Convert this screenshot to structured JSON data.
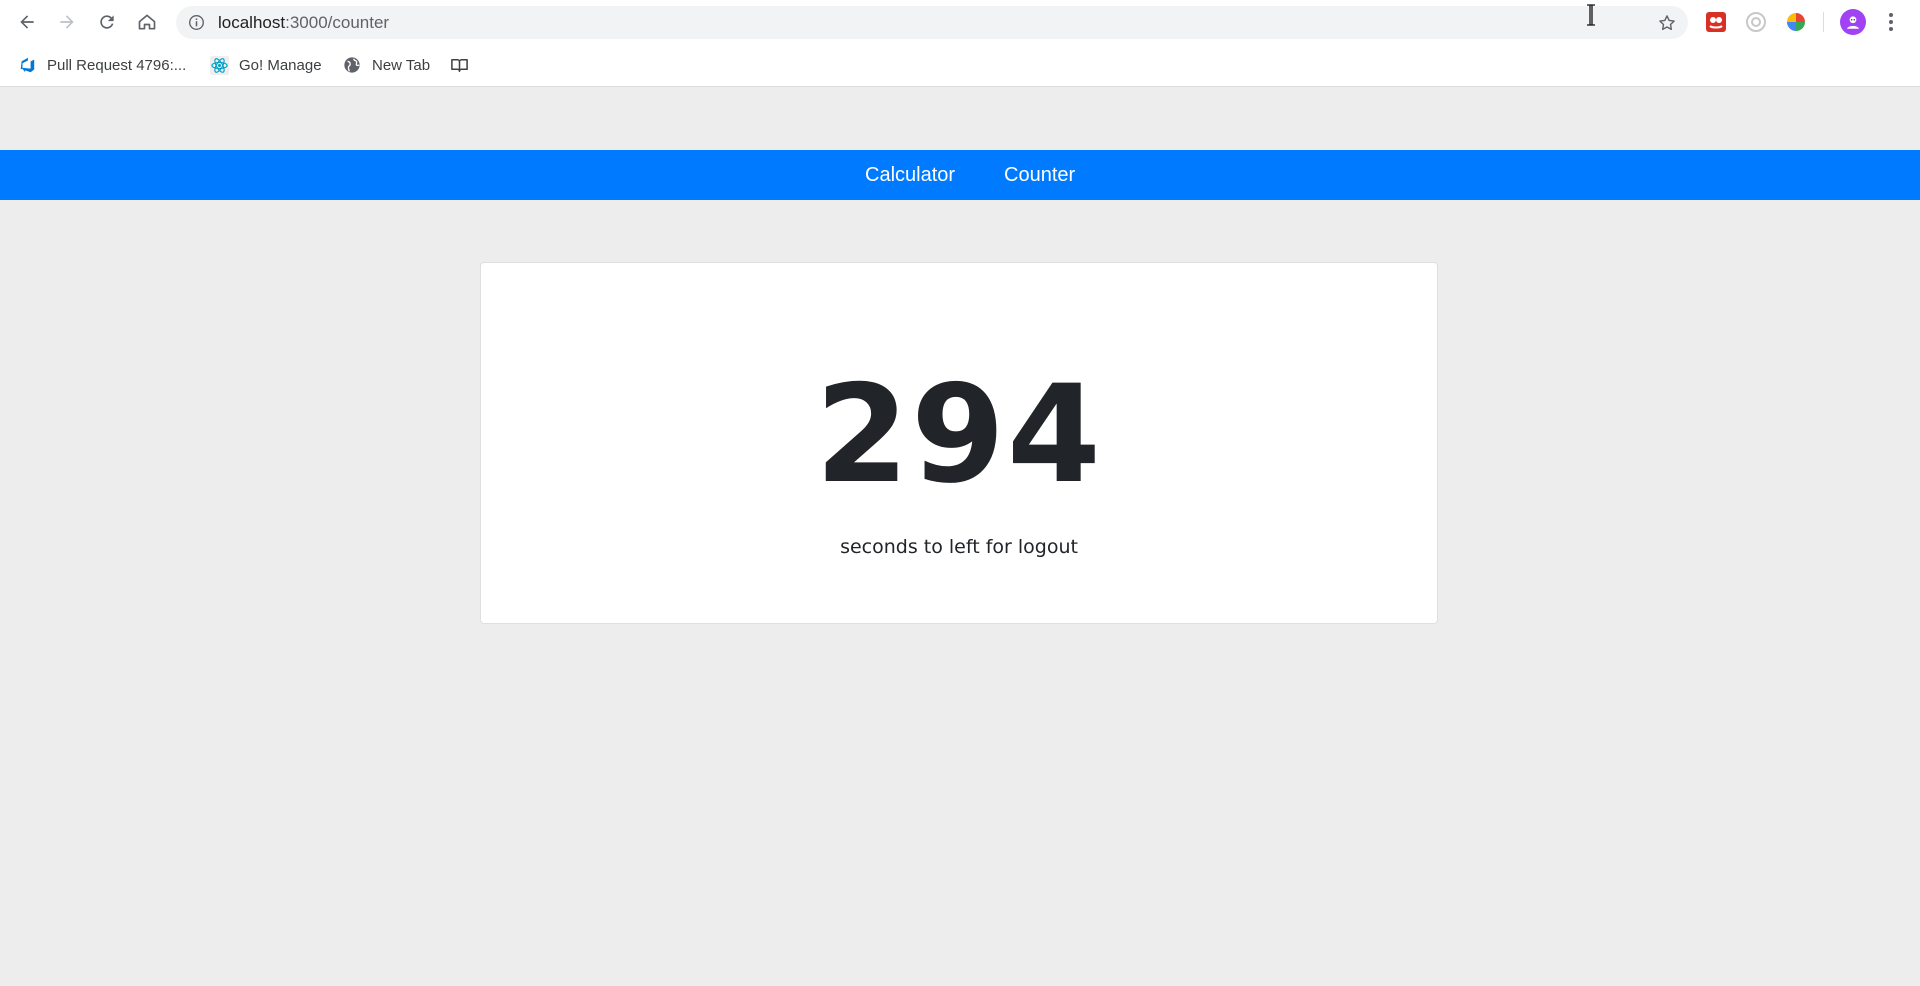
{
  "browser": {
    "url_host": "localhost",
    "url_path": ":3000/counter",
    "icons": {
      "back": "back-arrow-icon",
      "forward": "forward-arrow-icon",
      "reload": "reload-icon",
      "home": "home-icon",
      "info": "info-icon",
      "bookmark": "star-icon",
      "menu": "three-dots-menu-icon"
    },
    "extensions": [
      "red-extension-icon",
      "grey-circle-extension-icon",
      "color-wheel-extension-icon"
    ],
    "bookmarks": [
      {
        "label": "Pull Request 4796:...",
        "icon": "azure-devops-icon"
      },
      {
        "label": "Go! Manage",
        "icon": "react-atom-icon"
      },
      {
        "label": "New Tab",
        "icon": "globe-icon"
      },
      {
        "label": "",
        "icon": "book-icon"
      }
    ]
  },
  "nav": {
    "links": [
      "Calculator",
      "Counter"
    ],
    "color": "#007bff"
  },
  "counter": {
    "value": "294",
    "caption": "seconds to left for logout"
  }
}
